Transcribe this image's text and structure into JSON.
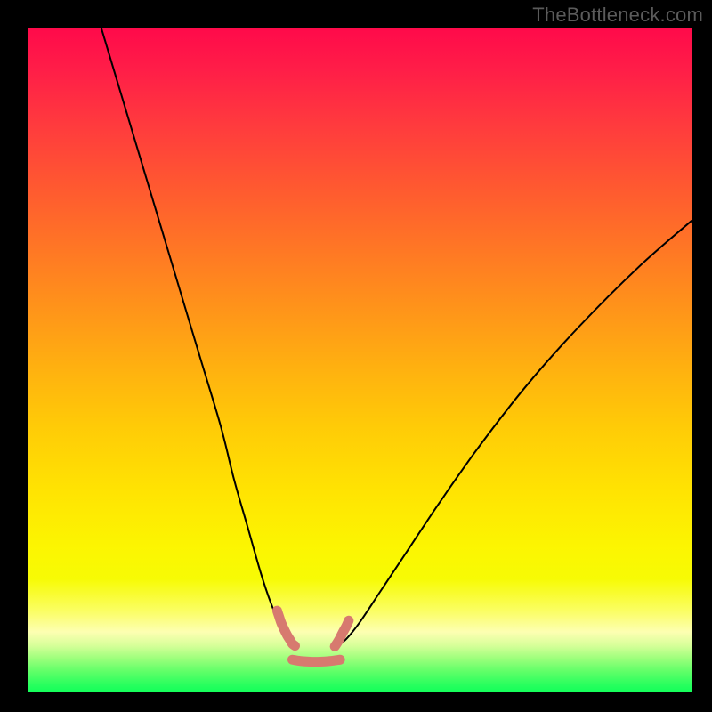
{
  "watermark": "TheBottleneck.com",
  "chart_data": {
    "type": "line",
    "title": "",
    "xlabel": "",
    "ylabel": "",
    "xlim": [
      0,
      100
    ],
    "ylim": [
      0,
      100
    ],
    "grid": false,
    "series": [
      {
        "name": "left-branch",
        "x": [
          11,
          14,
          17,
          20,
          23,
          26,
          29,
          31,
          33,
          35,
          36.5,
          38,
          39.3,
          40.3
        ],
        "y": [
          100,
          90,
          80,
          70,
          60,
          50,
          40,
          32,
          25,
          18,
          13.5,
          10,
          7.8,
          6.8
        ],
        "stroke": "#000000",
        "width": 2
      },
      {
        "name": "right-branch",
        "x": [
          46.5,
          48,
          50,
          53,
          57,
          62,
          68,
          75,
          83,
          92,
          100
        ],
        "y": [
          6.8,
          8,
          10.5,
          15,
          21,
          28.5,
          37,
          46,
          55,
          64,
          71
        ],
        "stroke": "#000000",
        "width": 2
      },
      {
        "name": "left-marker-band",
        "x": [
          37.5,
          37.8,
          38.1,
          38.5,
          39,
          39.5,
          39.8,
          40.2
        ],
        "y": [
          12.2,
          11.3,
          10.4,
          9.5,
          8.5,
          7.7,
          7.2,
          6.9
        ],
        "stroke": "#d77a6f",
        "width": 11
      },
      {
        "name": "right-marker-band",
        "x": [
          46.2,
          46.6,
          47.0,
          47.4,
          47.9,
          48.3
        ],
        "y": [
          6.8,
          7.4,
          8.1,
          8.9,
          9.8,
          10.7
        ],
        "stroke": "#d77a6f",
        "width": 11
      },
      {
        "name": "bottom-marker-band",
        "x": [
          39.8,
          41.0,
          42.5,
          44.0,
          45.5,
          47.0
        ],
        "y": [
          4.8,
          4.6,
          4.5,
          4.5,
          4.6,
          4.8
        ],
        "stroke": "#d77a6f",
        "width": 11
      }
    ],
    "background": {
      "type": "vertical-gradient",
      "stops": [
        {
          "pos": 0.0,
          "color": "#ff0a4a"
        },
        {
          "pos": 0.5,
          "color": "#ffb010"
        },
        {
          "pos": 0.8,
          "color": "#fcf501"
        },
        {
          "pos": 0.93,
          "color": "#9dff7c"
        },
        {
          "pos": 1.0,
          "color": "#14ff5a"
        }
      ]
    }
  }
}
